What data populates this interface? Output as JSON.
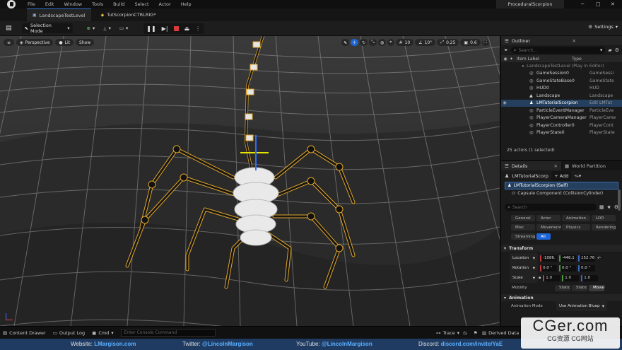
{
  "app": {
    "logo_icon": "unreal-logo-icon",
    "project": "ProceduralScorpion"
  },
  "menu": [
    "File",
    "Edit",
    "Window",
    "Tools",
    "Build",
    "Select",
    "Actor",
    "Help"
  ],
  "tabs": [
    {
      "label": "LandscapeTestLevel",
      "active": true
    },
    {
      "label": "TutScorpionCTRLRIG*",
      "active": false
    }
  ],
  "toolbar": {
    "mode": "Selection Mode",
    "settings": "Settings"
  },
  "viewport": {
    "perspective": "Perspective",
    "lit": "Lit",
    "show": "Show",
    "snap_grid": "10",
    "snap_rot": "10°",
    "snap_scale": "0.25",
    "cam_speed": "0.6"
  },
  "outliner": {
    "title": "Outliner",
    "search_placeholder": "Search...",
    "col_label": "Item Label",
    "col_type": "Type",
    "level_row": "LandscapeTestLevel (Play In Editor)",
    "rows": [
      {
        "name": "GameSession0",
        "type": "GameSessi",
        "selected": false
      },
      {
        "name": "GameStateBase0",
        "type": "GameState",
        "selected": false
      },
      {
        "name": "HUD0",
        "type": "HUD",
        "selected": false
      },
      {
        "name": "Landscape",
        "type": "Landscape",
        "selected": false
      },
      {
        "name": "LMTutorialScorpion",
        "type": "Edit LMTut",
        "selected": true
      },
      {
        "name": "ParticleEventManager",
        "type": "ParticleEve",
        "selected": false
      },
      {
        "name": "PlayerCameraManager",
        "type": "PlayerCame",
        "selected": false
      },
      {
        "name": "PlayerController0",
        "type": "PlayerCont",
        "selected": false
      },
      {
        "name": "PlayerState0",
        "type": "PlayerState",
        "selected": false
      }
    ],
    "count": "25 actors (1 selected)"
  },
  "details": {
    "tab_details": "Details",
    "tab_world": "World Partition",
    "actor_name": "LMTutorialScorpion",
    "add": "+ Add",
    "self_row": "LMTutorialScorpion (Self)",
    "component_row": "Capsule Component (CollisionCylinder)",
    "search_placeholder": "Search",
    "filters": [
      "General",
      "Actor",
      "Animation",
      "LOD",
      "Misc",
      "Movement",
      "Physics",
      "Rendering",
      "Streaming",
      "All"
    ],
    "transform_title": "Transform",
    "location_label": "Location",
    "location": [
      "-1086.",
      "-446.1",
      "152.76"
    ],
    "rotation_label": "Rotation",
    "rotation": [
      "0.0 °",
      "0.0 °",
      "0.0 °"
    ],
    "scale_label": "Scale",
    "scale": [
      "1.0",
      "1.0",
      "1.0"
    ],
    "mobility_label": "Mobility",
    "mobility": [
      "Static",
      "Static",
      "Moval"
    ],
    "animation_title": "Animation",
    "anim_mode_label": "Animation Mode",
    "anim_mode_value": "Use Animation Blueprin"
  },
  "bottombar": {
    "content_drawer": "Content Drawer",
    "output_log": "Output Log",
    "cmd": "Cmd",
    "console_placeholder": "Enter Console Command",
    "trace": "Trace",
    "derived_data": "Derived Data"
  },
  "footer": {
    "website_label": "Website:",
    "website": "LMargison.com",
    "twitter_label": "Twitter:",
    "twitter": "@LincolnMargison",
    "youtube_label": "YouTube:",
    "youtube": "@LincolnMargison",
    "discord_label": "Discord:",
    "discord": "discord.com/invite/YaE"
  },
  "watermark": {
    "main": "CGer.com",
    "sub": "CG资源 CG网站"
  },
  "colors": {
    "accent": "#1d65d8",
    "footer": "#1f3b62",
    "link": "#5db0ff",
    "record": "#d83b3b"
  }
}
